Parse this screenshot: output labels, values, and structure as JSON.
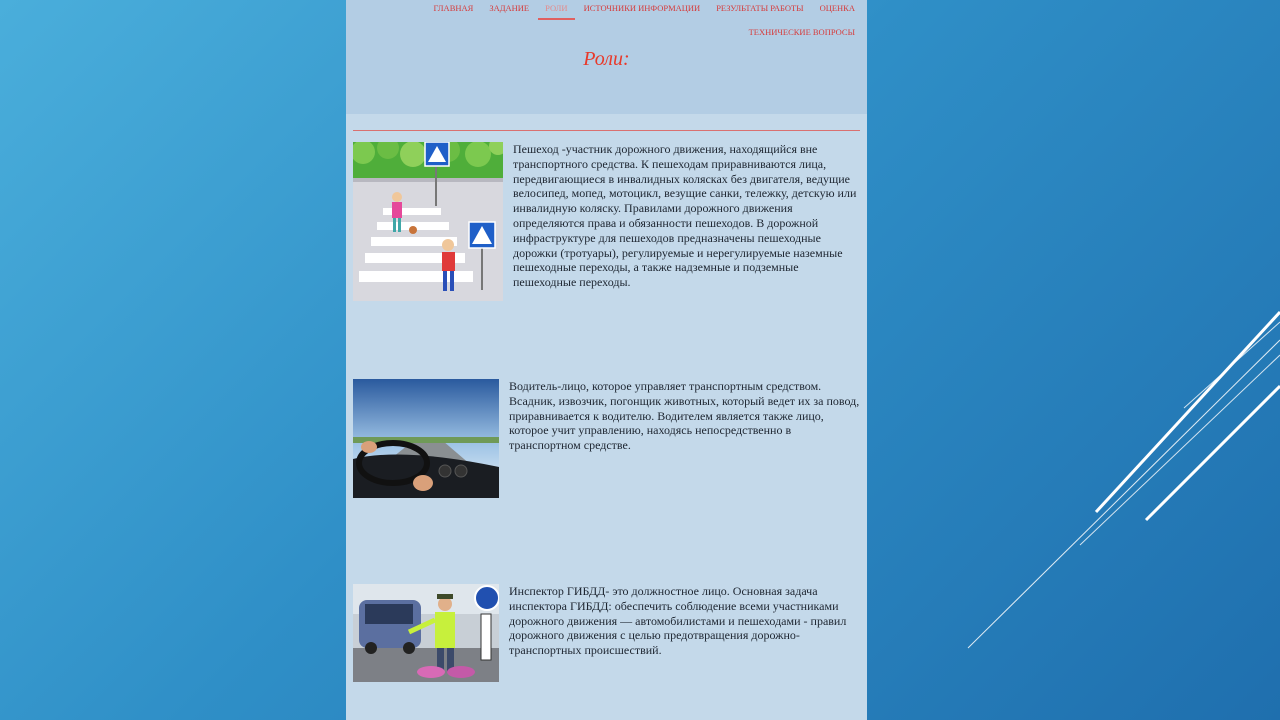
{
  "nav": {
    "items": [
      "ГЛАВНАЯ",
      "ЗАДАНИЕ",
      "РОЛИ",
      "ИСТОЧНИКИ ИНФОРМАЦИИ",
      "РЕЗУЛЬТАТЫ РАБОТЫ",
      "ОЦЕНКА",
      "ТЕХНИЧЕСКИЕ ВОПРОСЫ"
    ],
    "active": "РОЛИ"
  },
  "title": "Роли:",
  "roles": [
    {
      "image": "pedestrian-crossing-illustration",
      "text": "Пешеход -участник дорожного движения, находящийся вне транспортного средства. К пешеходам приравниваются лица, передвигающиеся в инвалидных колясках без двигателя, ведущие велосипед, мопед, мотоцикл, везущие санки, тележку, детскую или инвалидную коляску. Правилами дорожного движения определяются права и обязанности пешеходов. В дорожной инфраструктуре для пешеходов предназначены пешеходные дорожки (тротуары), регулируемые и нерегулируемые наземные пешеходные переходы, а также надземные и подземные пешеходные переходы."
    },
    {
      "image": "driver-steering-wheel-photo",
      "text": "Водитель-лицо, которое управляет транспортным средством. Всадник, извозчик, погонщик животных, который ведет их за повод, приравнивается к водителю. Водителем является также лицо, которое учит управлению, находясь непосредственно в транспортном средстве."
    },
    {
      "image": "traffic-inspector-photo",
      "text": "Инспектор ГИБДД- это должностное лицо. Основная задача инспектора ГИБДД: обеспечить соблюдение всеми участниками дорожного движения — автомобилистами и пешеходами - правил дорожного движения с целью предотвращения дорожно-транспортных происшествий."
    }
  ],
  "colors": {
    "background": "#2f8fc7",
    "page": "#c4d9ea",
    "header": "#b3cde4",
    "accent": "#e8392a"
  }
}
